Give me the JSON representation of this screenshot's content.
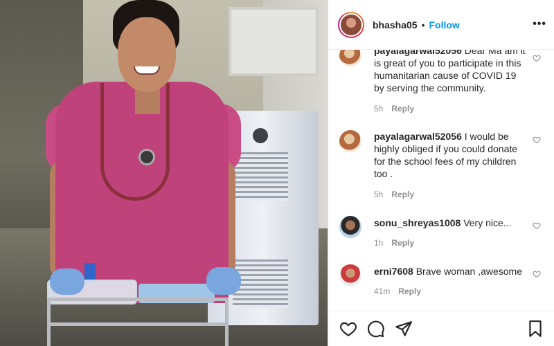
{
  "header": {
    "username": "bhasha05",
    "separator": "•",
    "follow_label": "Follow",
    "more_label": "•••"
  },
  "comments": [
    {
      "username": "payalagarwal52056",
      "text": "Dear Ma am it is great of you to participate in this humanitarian cause of COVID 19 by serving the community.",
      "time": "5h",
      "reply_label": "Reply",
      "avatar": "payal-avatar"
    },
    {
      "username": "payalagarwal52056",
      "text": "I would be highly obliged if you could donate for the school fees of my children too .",
      "time": "5h",
      "reply_label": "Reply",
      "avatar": "payal-avatar"
    },
    {
      "username": "sonu_shreyas1008",
      "text": "Very nice...",
      "time": "1h",
      "reply_label": "Reply",
      "avatar": "sonu-avatar"
    },
    {
      "username": "erni7608",
      "text": "Brave woman ,awesome",
      "time": "41m",
      "reply_label": "Reply",
      "avatar": "erni-avatar"
    }
  ],
  "actions": {
    "icons": [
      "heart-icon",
      "comment-icon",
      "share-icon",
      "bookmark-icon"
    ]
  },
  "colors": {
    "link": "#0095f6",
    "text": "#262626",
    "muted": "#8e8e8e",
    "scrubs": "#c0427a"
  }
}
